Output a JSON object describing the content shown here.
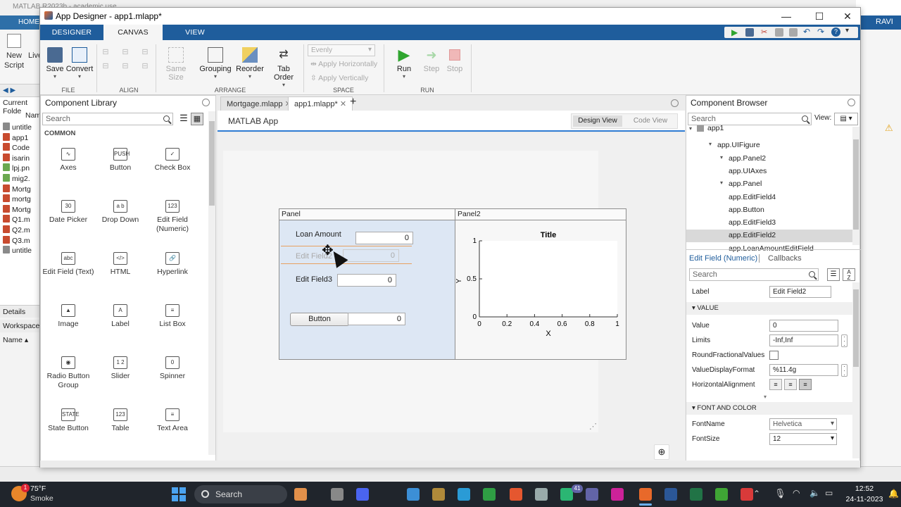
{
  "background": {
    "title": "MATLAB R2023b - academic use",
    "home_tab": "HOME",
    "new_script": "New Script",
    "live": "Live",
    "current_folder": "Current Folde",
    "name_col": "Nam",
    "files": [
      "untitle",
      "app1",
      "Code",
      "isarin",
      "lpj.pn",
      "mig2.",
      "Mortg",
      "mortg",
      "Mortg",
      "Q1.m",
      "Q2.m",
      "Q3.m",
      "untitle"
    ],
    "details": "Details",
    "workspace": "Workspace",
    "name_sort": "Name ▴",
    "user": "RAVI"
  },
  "window": {
    "title": "App Designer - app1.mlapp*",
    "tabs": [
      "DESIGNER",
      "CANVAS",
      "VIEW"
    ],
    "active_tab": "CANVAS"
  },
  "ribbon": {
    "file": {
      "save": "Save",
      "convert": "Convert",
      "section": "FILE"
    },
    "align": {
      "section": "ALIGN"
    },
    "arrange": {
      "same_size": "Same Size",
      "grouping": "Grouping",
      "reorder": "Reorder",
      "tab_order": "Tab Order",
      "section": "ARRANGE"
    },
    "space": {
      "evenly": "Evenly",
      "apply_h": "Apply Horizontally",
      "apply_v": "Apply Vertically",
      "section": "SPACE"
    },
    "run": {
      "run": "Run",
      "step": "Step",
      "stop": "Stop",
      "section": "RUN"
    }
  },
  "library": {
    "title": "Component Library",
    "search_placeholder": "Search",
    "category": "COMMON",
    "items": [
      {
        "label": "Axes",
        "glyph": "∿"
      },
      {
        "label": "Button",
        "glyph": "PUSH"
      },
      {
        "label": "Check Box",
        "glyph": "✓"
      },
      {
        "label": "Date Picker",
        "glyph": "30"
      },
      {
        "label": "Drop Down",
        "glyph": "a b"
      },
      {
        "label": "Edit Field (Numeric)",
        "glyph": "123"
      },
      {
        "label": "Edit Field (Text)",
        "glyph": "abc"
      },
      {
        "label": "HTML",
        "glyph": "</>"
      },
      {
        "label": "Hyperlink",
        "glyph": "🔗"
      },
      {
        "label": "Image",
        "glyph": "▲"
      },
      {
        "label": "Label",
        "glyph": "A"
      },
      {
        "label": "List Box",
        "glyph": "≡"
      },
      {
        "label": "Radio Button Group",
        "glyph": "◉"
      },
      {
        "label": "Slider",
        "glyph": "1 2"
      },
      {
        "label": "Spinner",
        "glyph": "0"
      },
      {
        "label": "State Button",
        "glyph": "STATE"
      },
      {
        "label": "Table",
        "glyph": "123"
      },
      {
        "label": "Text Area",
        "glyph": "≡"
      }
    ]
  },
  "doc_tabs": [
    "Mortgage.mlapp",
    "app1.mlapp*"
  ],
  "canvas": {
    "app_title": "MATLAB App",
    "design_view": "Design View",
    "code_view": "Code View",
    "panel_title": "Panel",
    "panel2_title": "Panel2",
    "loan_label": "Loan   Amount",
    "loan_value": "0",
    "drag_label": "Edit Field2",
    "drag_value": "0",
    "ef3_label": "Edit Field3",
    "ef3_value": "0",
    "button_label": "Button",
    "button_value": "0",
    "plot_title": "Title",
    "y_label": "Y",
    "x_label": "X",
    "y_ticks": [
      "0",
      "0.5",
      "1"
    ],
    "x_ticks": [
      "0",
      "0.2",
      "0.4",
      "0.6",
      "0.8",
      "1"
    ]
  },
  "browser": {
    "title": "Component Browser",
    "search_placeholder": "Search",
    "view_label": "View:",
    "tree": [
      {
        "label": "app1",
        "level": 0
      },
      {
        "label": "app.UIFigure",
        "level": 1
      },
      {
        "label": "app.Panel2",
        "level": 2
      },
      {
        "label": "app.UIAxes",
        "level": 3
      },
      {
        "label": "app.Panel",
        "level": 2
      },
      {
        "label": "app.EditField4",
        "level": 3
      },
      {
        "label": "app.Button",
        "level": 3
      },
      {
        "label": "app.EditField3",
        "level": 3
      },
      {
        "label": "app.EditField2",
        "level": 3,
        "selected": true
      },
      {
        "label": "app.LoanAmountEditField",
        "level": 3
      }
    ]
  },
  "inspector": {
    "tab_active": "Edit Field (Numeric)",
    "tab_callbacks": "Callbacks",
    "search_placeholder": "Search",
    "label_key": "Label",
    "label_value": "Edit Field2",
    "section_value": "VALUE",
    "value_key": "Value",
    "value_value": "0",
    "limits_key": "Limits",
    "limits_value": "-Inf,Inf",
    "round_key": "RoundFractionalValues",
    "vdf_key": "ValueDisplayFormat",
    "vdf_value": "%11.4g",
    "halign_key": "HorizontalAlignment",
    "section_font": "FONT AND COLOR",
    "fontname_key": "FontName",
    "fontname_value": "Helvetica",
    "fontsize_key": "FontSize",
    "fontsize_value": "12"
  },
  "taskbar": {
    "temp": "75°F",
    "weather": "Smoke",
    "search": "Search",
    "time": "12:52",
    "date": "24-11-2023",
    "badge": "41"
  },
  "colors": {
    "ribbon_blue": "#1f5d9c",
    "panel_fill": "#dde7f4",
    "selected_row": "#d9d9d9",
    "run_green": "#2fa52f"
  }
}
